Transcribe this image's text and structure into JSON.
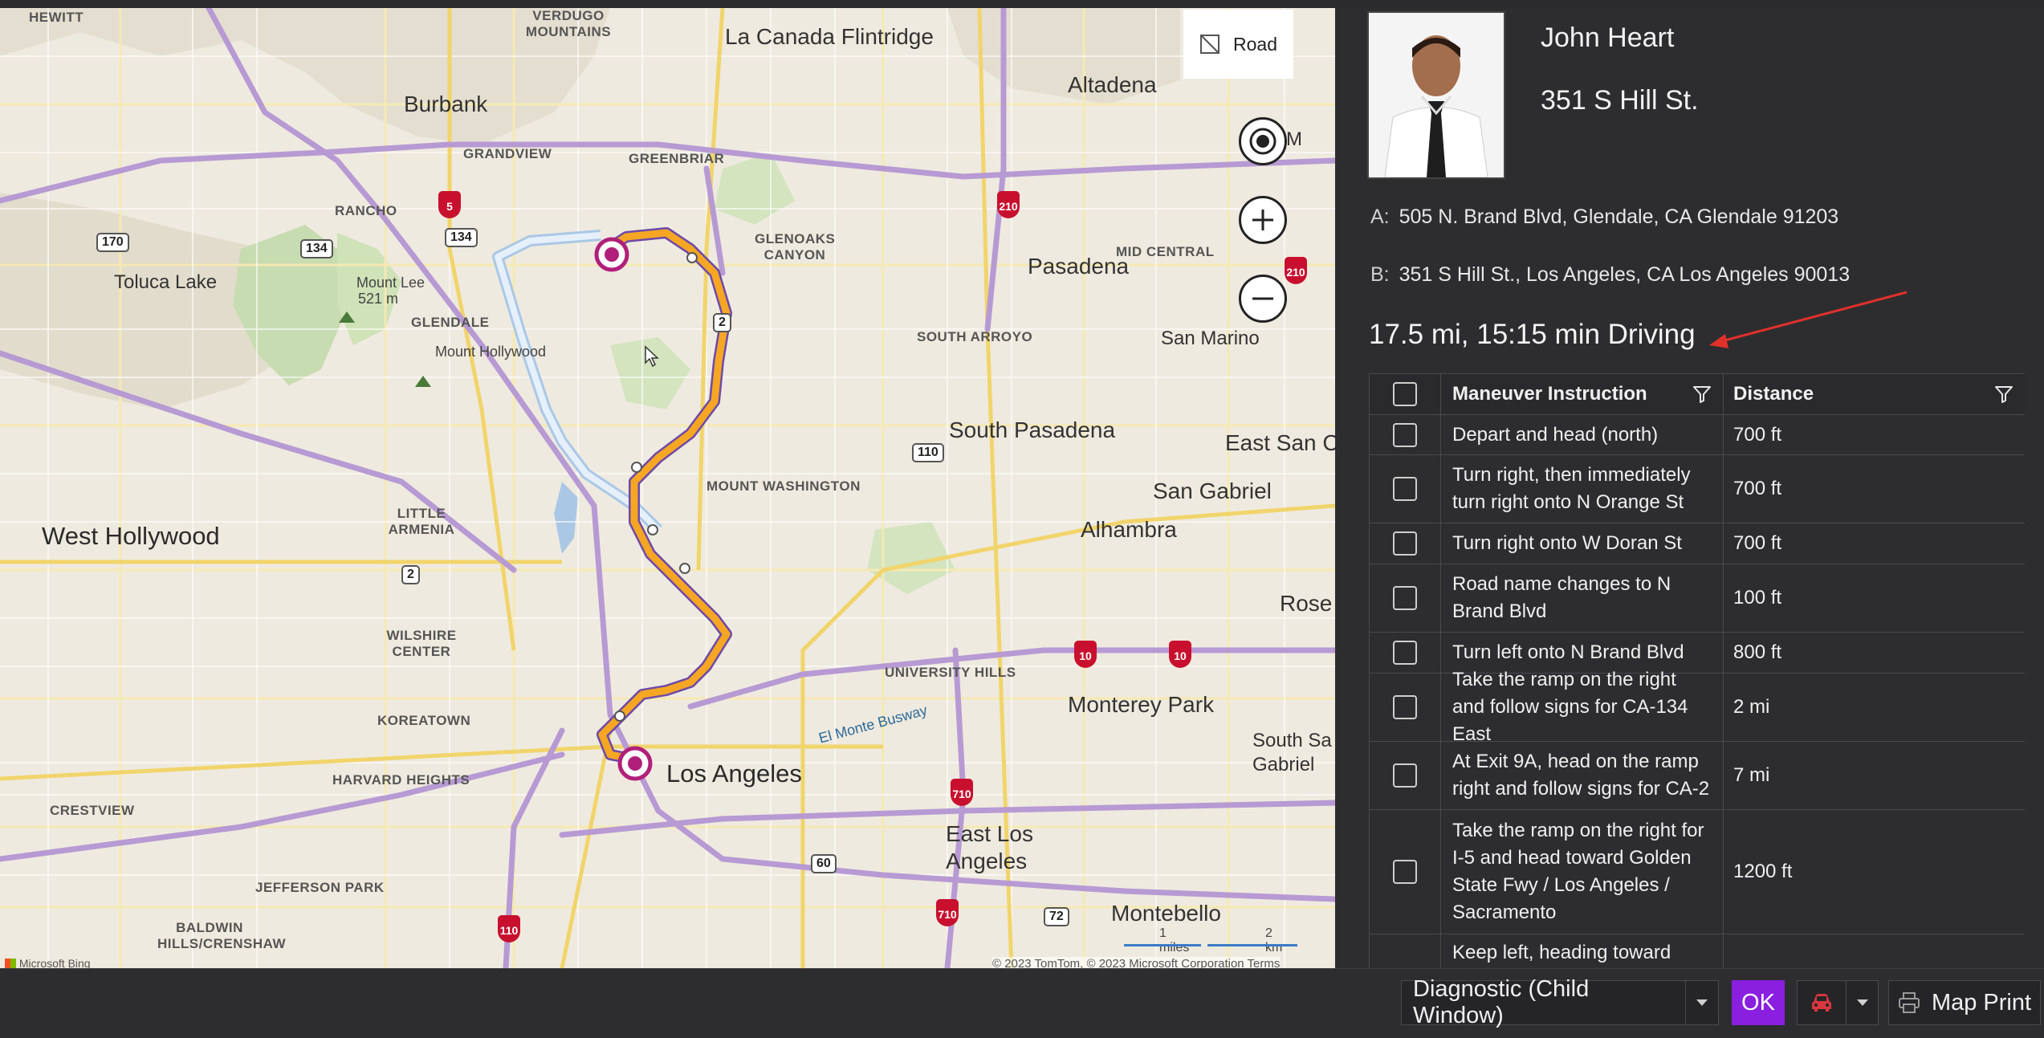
{
  "map": {
    "view_toggle_label": "Road",
    "labels": {
      "hewitt": "HEWITT",
      "verdugo": "VERDUGO MOUNTAINS",
      "la_canada": "La Canada Flintridge",
      "altadena": "Altadena",
      "burbank": "Burbank",
      "grandview": "GRANDVIEW",
      "greenbriar": "GREENBRIAR",
      "rancho": "RANCHO",
      "toluca_lake": "Toluca Lake",
      "mount_lee": "Mount Lee",
      "mount_lee_elev": "521 m",
      "glendale": "GLENDALE",
      "mount_hollywood": "Mount Hollywood",
      "glenoaks_canyon": "GLENOAKS CANYON",
      "mid_central": "MID CENTRAL",
      "pasadena": "Pasadena",
      "south_arroyo": "SOUTH ARROYO",
      "san_marino": "San Marino",
      "south_pasadena": "South Pasadena",
      "east_san": "East San C",
      "west_hollywood": "West Hollywood",
      "little_armenia": "LITTLE ARMENIA",
      "mount_washington": "MOUNT WASHINGTON",
      "san_gabriel": "San Gabriel",
      "alhambra": "Alhambra",
      "rose": "Rose",
      "wilshire_center": "WILSHIRE CENTER",
      "university_hills": "UNIVERSITY HILLS",
      "koreatown": "KOREATOWN",
      "monterey_park": "Monterey Park",
      "south_san_gabriel": "South Sa Gabriel",
      "el_monte_busway": "El Monte Busway",
      "harvard_heights": "HARVARD HEIGHTS",
      "los_angeles": "Los Angeles",
      "crestview": "CRESTVIEW",
      "east_los_angeles": "East Los Angeles",
      "jefferson_park": "JEFFERSON PARK",
      "baldwin_hills": "BALDWIN HILLS/CRENSHAW",
      "montebello": "Montebello",
      "eloa": "eloa M"
    },
    "shields": {
      "r170": "170",
      "r134a": "134",
      "r134b": "134",
      "i5": "5",
      "r2a": "2",
      "r210a": "210",
      "r110a": "110",
      "r2b": "2",
      "i10a": "10",
      "i10b": "10",
      "i710a": "710",
      "r60": "60",
      "i710b": "710",
      "r72": "72",
      "i110": "110",
      "i210b": "210"
    },
    "scale_miles": "1 miles",
    "scale_km": "2 km",
    "attribution": "Microsoft Bing",
    "copyright": "© 2023 TomTom, © 2023 Microsoft Corporation   Terms",
    "route_color": "#f5a623",
    "alt_route_color": "#cfe3f7",
    "pin_color": "#b0207a"
  },
  "contact": {
    "name": "John Heart",
    "address": "351 S Hill St."
  },
  "route": {
    "a_key": "A:",
    "a_value": "505 N. Brand Blvd, Glendale, CA Glendale 91203",
    "b_key": "B:",
    "b_value": "351 S Hill St., Los Angeles, CA Los Angeles 90013",
    "summary": "17.5 mi, 15:15 min Driving"
  },
  "grid": {
    "col_instruction": "Maneuver Instruction",
    "col_distance": "Distance",
    "rows": [
      {
        "instruction": "Depart and head (north)",
        "distance": "700 ft"
      },
      {
        "instruction": "Turn right, then immediately turn right onto N Orange St",
        "distance": "700 ft"
      },
      {
        "instruction": "Turn right onto W Doran St",
        "distance": "700 ft"
      },
      {
        "instruction": "Road name changes to N Brand Blvd",
        "distance": "100 ft"
      },
      {
        "instruction": "Turn left onto N Brand Blvd",
        "distance": "800 ft"
      },
      {
        "instruction": "Take the ramp on the right and follow signs for CA-134 East",
        "distance": "2 mi"
      },
      {
        "instruction": "At Exit 9A, head on the ramp right and follow signs for CA-2",
        "distance": "7 mi"
      },
      {
        "instruction": "Take the ramp on the right for I-5 and head toward Golden State Fwy / Los Angeles / Sacramento",
        "distance": "1200 ft"
      },
      {
        "instruction": "Keep left, heading toward",
        "distance": ""
      }
    ]
  },
  "footer": {
    "combo_value": "Diagnostic (Child Window)",
    "ok_label": "OK",
    "print_label": "Map Print",
    "ok_color": "#8a1fe0",
    "car_icon_color": "#d9363e"
  }
}
